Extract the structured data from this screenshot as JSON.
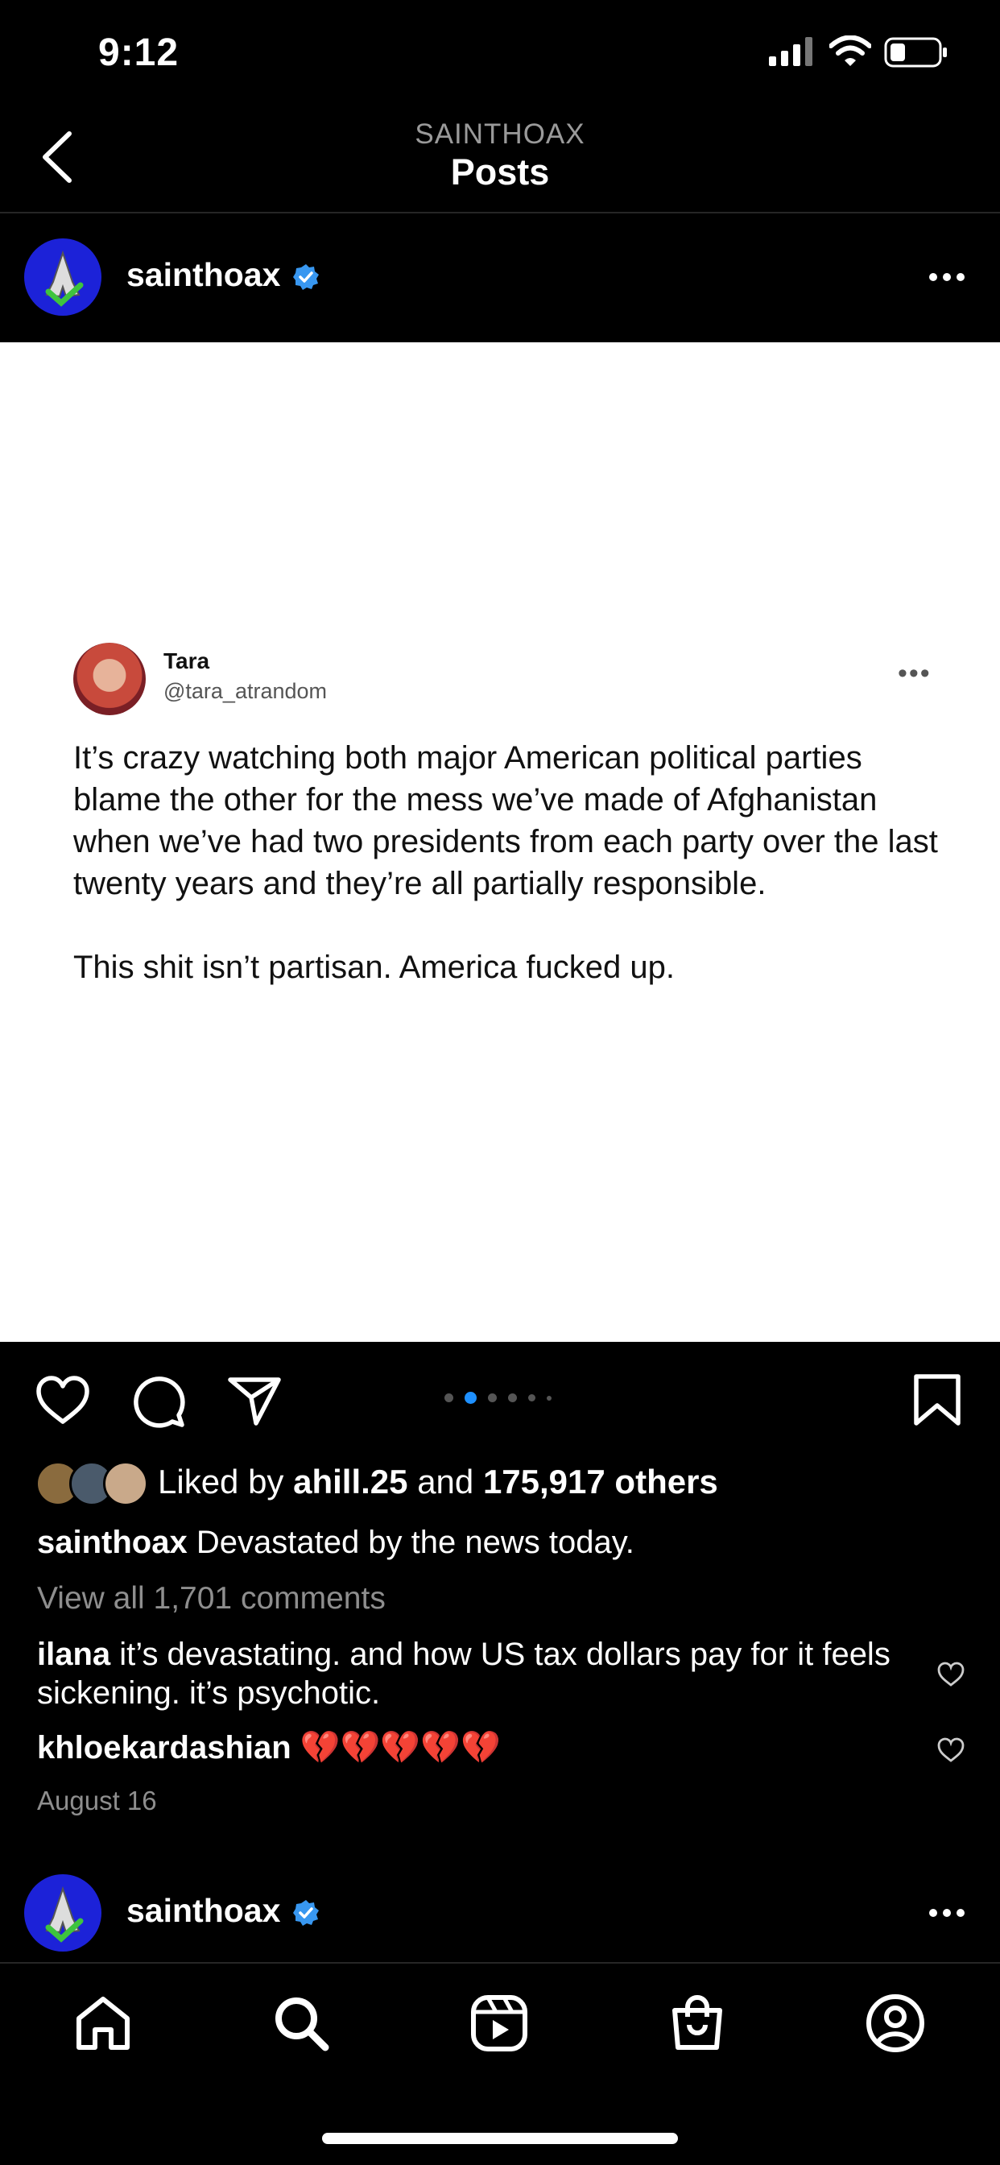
{
  "status_bar": {
    "time": "9:12"
  },
  "header": {
    "account": "SAINTHOAX",
    "title": "Posts"
  },
  "post": {
    "username": "sainthoax",
    "tweet": {
      "name": "Tara",
      "handle": "@tara_atrandom",
      "paragraphs": [
        "It’s crazy watching both major American political parties blame the other for the mess we’ve made of Afghanistan when we’ve had two presidents from each party over the last twenty years and they’re all partially responsible.",
        "This shit isn’t partisan. America fucked up."
      ]
    },
    "carousel": {
      "total": 6,
      "active_index": 1
    },
    "likes": {
      "prefix": "Liked by",
      "user": "ahill.25",
      "and": "and",
      "others": "175,917 others"
    },
    "caption": {
      "user": "sainthoax",
      "text": "Devastated by the news today."
    },
    "view_comments": "View all 1,701 comments",
    "comments": [
      {
        "user": "ilana",
        "text": "it’s devastating. and how US tax dollars pay for it feels sickening. it’s psychotic."
      },
      {
        "user": "khloekardashian",
        "text": "💔💔💔💔💔"
      }
    ],
    "date": "August 16"
  },
  "next_post": {
    "username": "sainthoax"
  },
  "colors": {
    "verified": "#3897f0",
    "carousel_active": "#1e90ff",
    "avatar_bg": "#1c22d8"
  },
  "icons": [
    "back-chevron-icon",
    "heart-icon",
    "comment-icon",
    "share-icon",
    "bookmark-icon",
    "home-icon",
    "search-icon",
    "reels-icon",
    "shop-icon",
    "profile-icon"
  ]
}
